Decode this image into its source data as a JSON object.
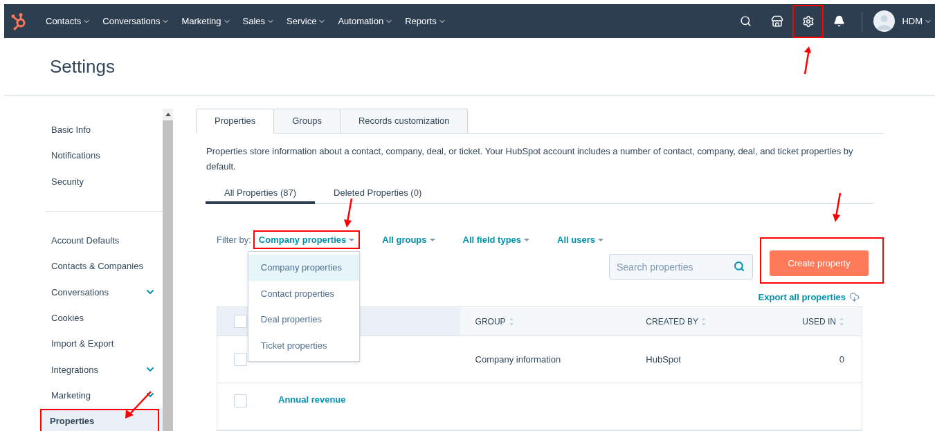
{
  "top_nav": {
    "menu": [
      {
        "label": "Contacts"
      },
      {
        "label": "Conversations"
      },
      {
        "label": "Marketing"
      },
      {
        "label": "Sales"
      },
      {
        "label": "Service"
      },
      {
        "label": "Automation"
      },
      {
        "label": "Reports"
      }
    ],
    "icons": [
      {
        "kind": "search",
        "highlighted": false
      },
      {
        "kind": "marketplace",
        "highlighted": false
      },
      {
        "kind": "settings",
        "highlighted": true,
        "arrow": true
      },
      {
        "kind": "notifications",
        "highlighted": false
      }
    ],
    "account": "HDM"
  },
  "page_title": "Settings",
  "sidebar": {
    "groups": [
      [
        {
          "label": "Basic Info",
          "selected": false,
          "expandable": false,
          "highlighted": false
        },
        {
          "label": "Notifications",
          "selected": false,
          "expandable": false,
          "highlighted": false
        },
        {
          "label": "Security",
          "selected": false,
          "expandable": false,
          "highlighted": false
        }
      ],
      [
        {
          "label": "Account Defaults",
          "selected": false,
          "expandable": false,
          "highlighted": false
        },
        {
          "label": "Contacts & Companies",
          "selected": false,
          "expandable": false,
          "highlighted": false
        },
        {
          "label": "Conversations",
          "selected": false,
          "expandable": true,
          "highlighted": false
        },
        {
          "label": "Cookies",
          "selected": false,
          "expandable": false,
          "highlighted": false
        },
        {
          "label": "Import & Export",
          "selected": false,
          "expandable": false,
          "highlighted": false
        },
        {
          "label": "Integrations",
          "selected": false,
          "expandable": true,
          "highlighted": false
        },
        {
          "label": "Marketing",
          "selected": false,
          "expandable": true,
          "highlighted": false
        },
        {
          "label": "Properties",
          "selected": true,
          "expandable": false,
          "highlighted": true,
          "arrow": true
        }
      ]
    ]
  },
  "tabs": [
    {
      "label": "Properties",
      "selected": true
    },
    {
      "label": "Groups",
      "selected": false
    },
    {
      "label": "Records customization",
      "selected": false
    }
  ],
  "description": "Properties store information about a contact, company, deal, or ticket. Your HubSpot account includes a number of contact, company, deal, and ticket properties by default.",
  "subtabs": [
    {
      "label": "All Properties (87)",
      "selected": true
    },
    {
      "label": "Deleted Properties (0)",
      "selected": false
    }
  ],
  "filters": {
    "label": "Filter by:",
    "items": [
      {
        "label": "Company properties",
        "highlighted": true,
        "arrow": true,
        "options": [
          {
            "label": "Company properties",
            "selected": true
          },
          {
            "label": "Contact properties",
            "selected": false
          },
          {
            "label": "Deal properties",
            "selected": false
          },
          {
            "label": "Ticket properties",
            "selected": false
          }
        ]
      },
      {
        "label": "All groups",
        "highlighted": false
      },
      {
        "label": "All field types",
        "highlighted": false
      },
      {
        "label": "All users",
        "highlighted": false
      }
    ]
  },
  "search": {
    "placeholder": "Search properties"
  },
  "create_button": {
    "label": "Create property",
    "highlighted": true,
    "arrow": true
  },
  "export_link": "Export all properties",
  "table": {
    "header_checked": false,
    "columns": [
      {
        "label": "GROUP",
        "sortable": true
      },
      {
        "label": "CREATED BY",
        "sortable": true
      },
      {
        "label": "USED IN",
        "sortable": true
      }
    ],
    "rows": [
      {
        "checked": false,
        "group": "Company information",
        "created_by": "HubSpot",
        "used_in": "0"
      },
      {
        "checked": false,
        "name": "Annual revenue"
      }
    ]
  }
}
